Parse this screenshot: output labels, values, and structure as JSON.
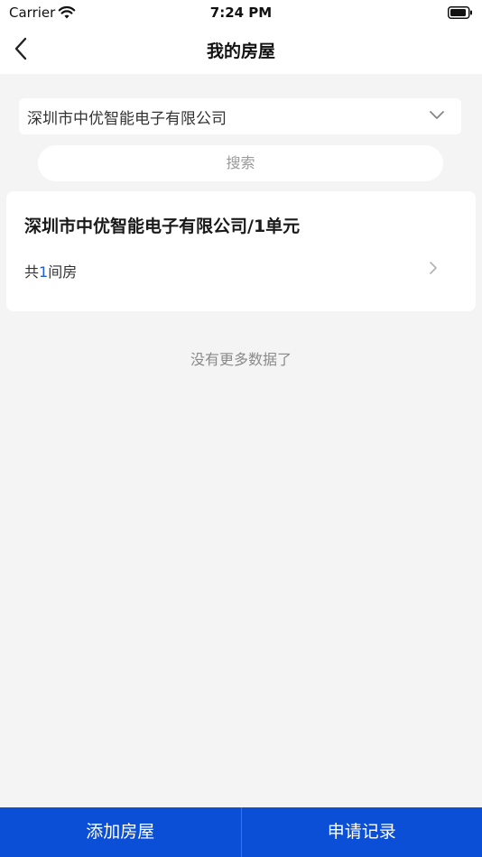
{
  "status_bar": {
    "carrier": "Carrier",
    "time": "7:24 PM"
  },
  "nav": {
    "title": "我的房屋",
    "back_icon": "chevron-left-icon"
  },
  "filter": {
    "company_selected": "深圳市中优智能电子有限公司",
    "dropdown_icon": "chevron-down-icon",
    "search_label": "搜索"
  },
  "houses": [
    {
      "title": "深圳市中优智能电子有限公司/1单元",
      "count_prefix": "共",
      "count": "1",
      "count_suffix": "间房"
    }
  ],
  "list_footer": "没有更多数据了",
  "bottom_bar": {
    "add_label": "添加房屋",
    "records_label": "申请记录"
  },
  "colors": {
    "accent": "#0a4fd6",
    "count_highlight": "#1f5fd6",
    "background": "#f4f4f5"
  }
}
